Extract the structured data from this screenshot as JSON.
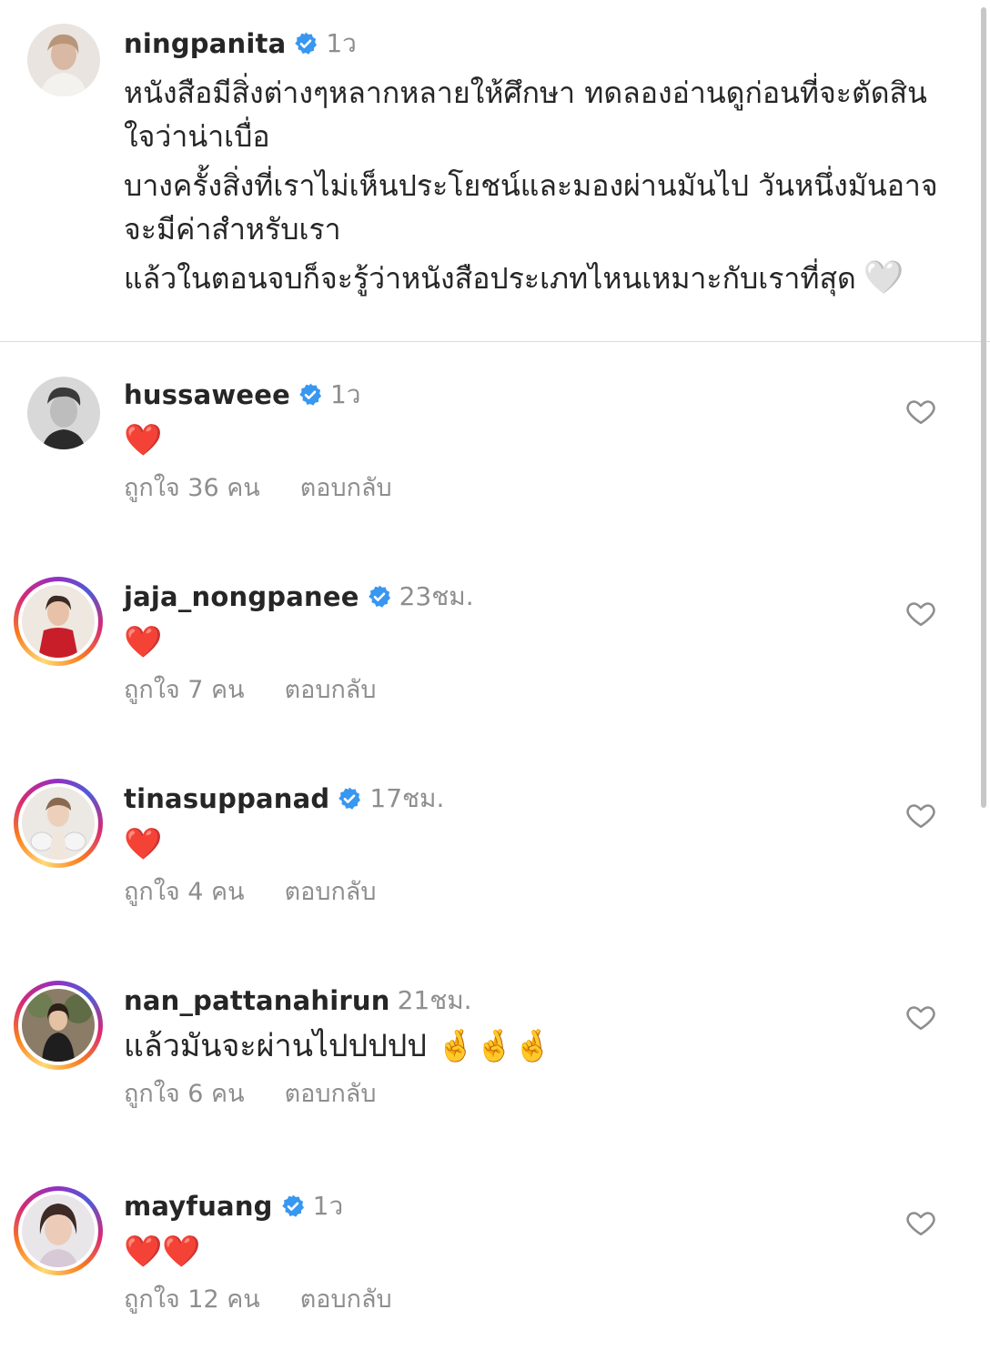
{
  "post": {
    "username": "ningpanita",
    "verified": true,
    "time": "1ว",
    "caption_lines": [
      "หนังสือมีสิ่งต่างๆหลากหลายให้ศึกษา ทดลองอ่านดูก่อนที่จะตัดสินใจว่าน่าเบื่อ",
      "บางครั้งสิ่งที่เราไม่เห็นประโยชน์และมองผ่านมันไป วันหนึ่งมันอาจจะมีค่าสำหรับเรา",
      "แล้วในตอนจบก็จะรู้ว่าหนังสือประเภทไหนเหมาะกับเราที่สุด"
    ],
    "caption_emoji": "🤍"
  },
  "comments": [
    {
      "username": "hussaweee",
      "verified": true,
      "time": "1ว",
      "text": "❤️",
      "likes": "ถูกใจ 36 คน",
      "reply": "ตอบกลับ"
    },
    {
      "username": "jaja_nongpanee",
      "verified": true,
      "time": "23ชม.",
      "text": "❤️",
      "likes": "ถูกใจ 7 คน",
      "reply": "ตอบกลับ"
    },
    {
      "username": "tinasuppanad",
      "verified": true,
      "time": "17ชม.",
      "text": "❤️",
      "likes": "ถูกใจ 4 คน",
      "reply": "ตอบกลับ"
    },
    {
      "username": "nan_pattanahirun",
      "verified": false,
      "time": "21ชม.",
      "text": "แล้วมันจะผ่านไปปปปป 🤞🤞🤞",
      "likes": "ถูกใจ 6 คน",
      "reply": "ตอบกลับ"
    },
    {
      "username": "mayfuang",
      "verified": true,
      "time": "1ว",
      "text": "❤️❤️",
      "likes": "ถูกใจ 12 คน",
      "reply": "ตอบกลับ"
    }
  ],
  "colors": {
    "verified_blue": "#3897f0",
    "muted_text": "#8e8e8e",
    "heart_red": "#e0245e"
  },
  "icons": {
    "verified": "verified-badge-icon",
    "like": "heart-outline-icon"
  }
}
